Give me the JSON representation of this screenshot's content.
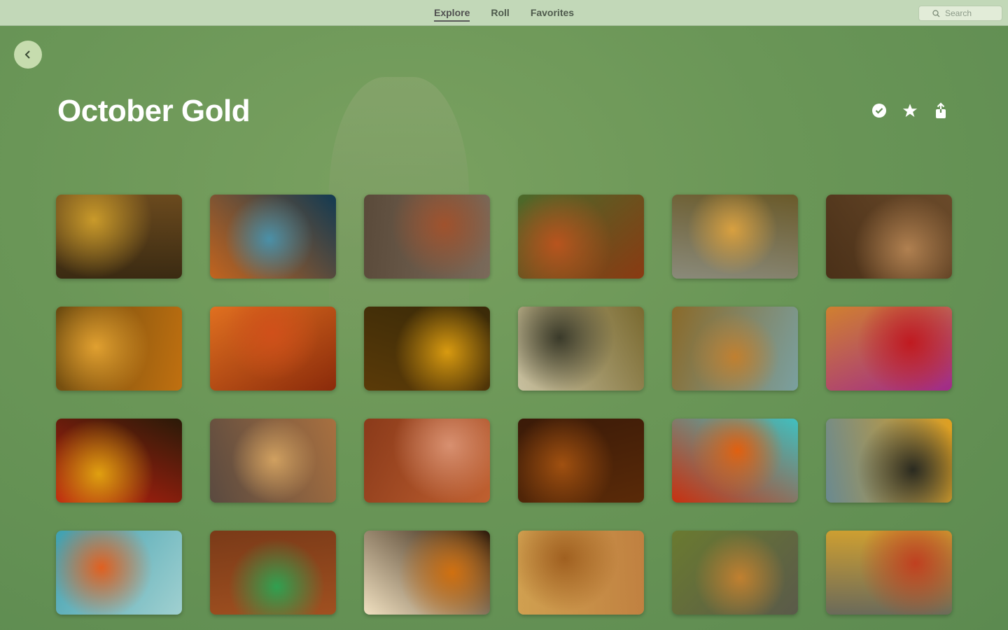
{
  "nav": {
    "tabs": [
      {
        "label": "Explore"
      },
      {
        "label": "Roll"
      },
      {
        "label": "Favorites"
      }
    ],
    "search_placeholder": "Search"
  },
  "album": {
    "title": "October Gold"
  },
  "photos": [
    [
      "#3a2a12",
      "#c99a2a",
      "#6b4a1e"
    ],
    [
      "#c2641e",
      "#4a90a8",
      "#123a52"
    ],
    [
      "#5a4a3a",
      "#a0522d",
      "#7a6a5a"
    ],
    [
      "#4a6a2a",
      "#b8541e",
      "#8a3a12"
    ],
    [
      "#6a5a2a",
      "#d8a040",
      "#8a8a7a"
    ],
    [
      "#6a4a2a",
      "#b08050",
      "#4a3018"
    ],
    [
      "#c07010",
      "#e0a030",
      "#6a4a10"
    ],
    [
      "#8a2a0a",
      "#d0501a",
      "#e07020"
    ],
    [
      "#5a3a08",
      "#d89a10",
      "#3a2a08"
    ],
    [
      "#c8c0a0",
      "#3a3a2a",
      "#7a6a30"
    ],
    [
      "#8a6a2a",
      "#c08030",
      "#7aa0a0"
    ],
    [
      "#d08030",
      "#c01a20",
      "#a02a8a"
    ],
    [
      "#2a1a08",
      "#e0a010",
      "#c02010"
    ],
    [
      "#a87040",
      "#d0a060",
      "#5a4a40"
    ],
    [
      "#c06030",
      "#d89070",
      "#8a3a1a"
    ],
    [
      "#5a2a08",
      "#a05010",
      "#3a1a08"
    ],
    [
      "#c83010",
      "#e06010",
      "#40c0c0"
    ],
    [
      "#6a8a90",
      "#2a2a20",
      "#e0a020"
    ],
    [
      "#40a0b0",
      "#e06020",
      "#a0d0d0"
    ],
    [
      "#7a3a18",
      "#30a050",
      "#a05020"
    ],
    [
      "#2a1808",
      "#d07010",
      "#f0e0c0"
    ],
    [
      "#c08040",
      "#a06020",
      "#d0a050"
    ],
    [
      "#5a5a4a",
      "#c08030",
      "#6a7a30"
    ],
    [
      "#6a6a5a",
      "#c04020",
      "#d0a030"
    ]
  ]
}
